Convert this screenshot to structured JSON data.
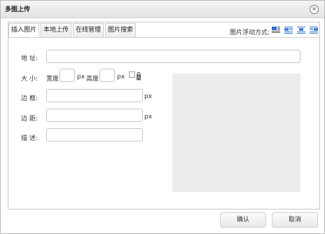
{
  "dialog": {
    "title": "多图上传",
    "close_symbol": "×"
  },
  "tabs": [
    {
      "label": "插入图片",
      "active": true
    },
    {
      "label": "本地上传",
      "active": false
    },
    {
      "label": "在线管理",
      "active": false
    },
    {
      "label": "图片搜索",
      "active": false
    }
  ],
  "float": {
    "label": "图片浮动方式:",
    "options": [
      "float-none-icon",
      "float-left-icon",
      "float-center-icon",
      "float-right-icon"
    ],
    "selected": 0,
    "accent": "#2a6ecf"
  },
  "form": {
    "address_label": "地 址:",
    "address_value": "",
    "size_label": "大 小:",
    "width_label": "宽度",
    "width_value": "",
    "height_label": "高度",
    "height_value": "",
    "unit_px": "px",
    "border_label": "边 框:",
    "border_value": "",
    "margin_label": "边 距:",
    "margin_value": "",
    "desc_label": "描 述:",
    "desc_value": ""
  },
  "buttons": {
    "ok": "确认",
    "cancel": "取消"
  }
}
